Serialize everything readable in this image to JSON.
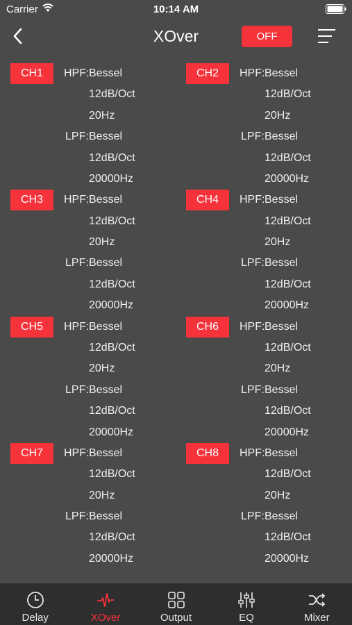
{
  "status": {
    "carrier": "Carrier",
    "time": "10:14 AM"
  },
  "nav": {
    "title": "XOver",
    "off_label": "OFF"
  },
  "labels": {
    "hpf": "HPF:",
    "lpf": "LPF:"
  },
  "channels": [
    {
      "name": "CH1",
      "hpf": [
        "Bessel",
        "12dB/Oct",
        "20Hz"
      ],
      "lpf": [
        "Bessel",
        "12dB/Oct",
        "20000Hz"
      ]
    },
    {
      "name": "CH2",
      "hpf": [
        "Bessel",
        "12dB/Oct",
        "20Hz"
      ],
      "lpf": [
        "Bessel",
        "12dB/Oct",
        "20000Hz"
      ]
    },
    {
      "name": "CH3",
      "hpf": [
        "Bessel",
        "12dB/Oct",
        "20Hz"
      ],
      "lpf": [
        "Bessel",
        "12dB/Oct",
        "20000Hz"
      ]
    },
    {
      "name": "CH4",
      "hpf": [
        "Bessel",
        "12dB/Oct",
        "20Hz"
      ],
      "lpf": [
        "Bessel",
        "12dB/Oct",
        "20000Hz"
      ]
    },
    {
      "name": "CH5",
      "hpf": [
        "Bessel",
        "12dB/Oct",
        "20Hz"
      ],
      "lpf": [
        "Bessel",
        "12dB/Oct",
        "20000Hz"
      ]
    },
    {
      "name": "CH6",
      "hpf": [
        "Bessel",
        "12dB/Oct",
        "20Hz"
      ],
      "lpf": [
        "Bessel",
        "12dB/Oct",
        "20000Hz"
      ]
    },
    {
      "name": "CH7",
      "hpf": [
        "Bessel",
        "12dB/Oct",
        "20Hz"
      ],
      "lpf": [
        "Bessel",
        "12dB/Oct",
        "20000Hz"
      ]
    },
    {
      "name": "CH8",
      "hpf": [
        "Bessel",
        "12dB/Oct",
        "20Hz"
      ],
      "lpf": [
        "Bessel",
        "12dB/Oct",
        "20000Hz"
      ]
    }
  ],
  "tabs": [
    {
      "label": "Delay",
      "icon": "clock-icon"
    },
    {
      "label": "XOver",
      "icon": "pulse-icon",
      "active": true
    },
    {
      "label": "Output",
      "icon": "grid-icon"
    },
    {
      "label": "EQ",
      "icon": "sliders-icon"
    },
    {
      "label": "Mixer",
      "icon": "shuffle-icon"
    }
  ],
  "colors": {
    "accent": "#f6323a",
    "background": "#4a4a4a",
    "tabbar": "#2e2e2e"
  }
}
